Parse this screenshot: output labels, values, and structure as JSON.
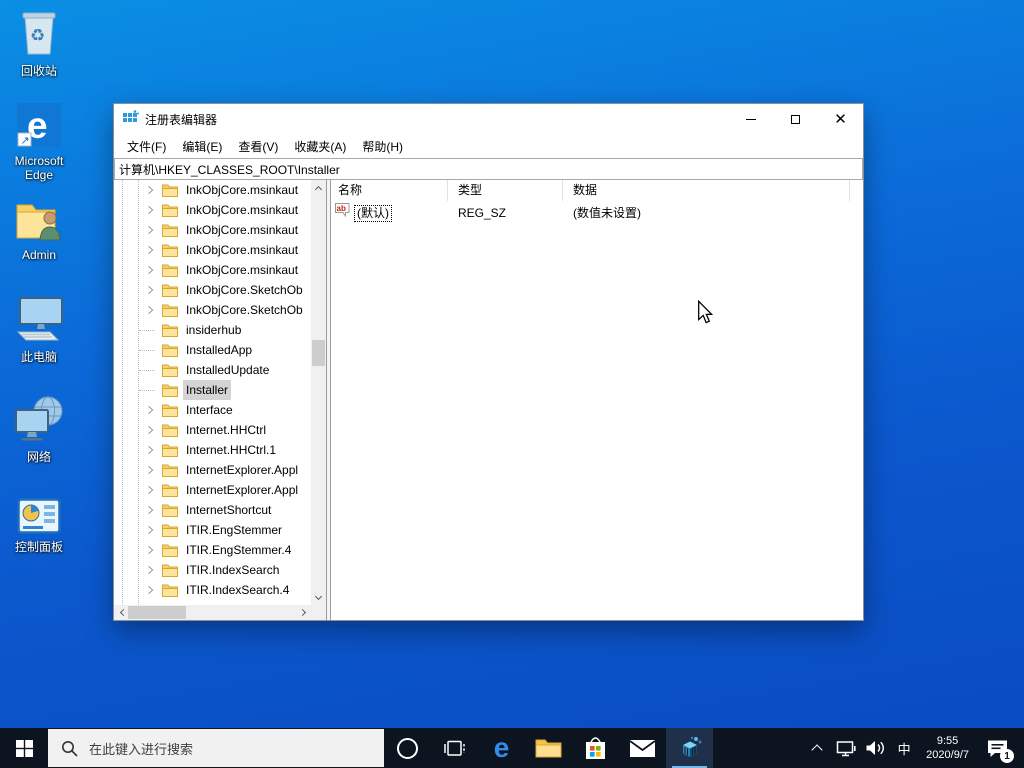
{
  "desktop": {
    "icons": [
      {
        "label": "回收站"
      },
      {
        "label": "Microsoft Edge"
      },
      {
        "label": "Admin"
      },
      {
        "label": "此电脑"
      },
      {
        "label": "网络"
      },
      {
        "label": "控制面板"
      }
    ]
  },
  "window": {
    "title": "注册表编辑器",
    "menu": [
      "文件(F)",
      "编辑(E)",
      "查看(V)",
      "收藏夹(A)",
      "帮助(H)"
    ],
    "address": "计算机\\HKEY_CLASSES_ROOT\\Installer",
    "tree": {
      "items": [
        {
          "label": "InkObjCore.msinkaut",
          "expandable": true
        },
        {
          "label": "InkObjCore.msinkaut",
          "expandable": true
        },
        {
          "label": "InkObjCore.msinkaut",
          "expandable": true
        },
        {
          "label": "InkObjCore.msinkaut",
          "expandable": true
        },
        {
          "label": "InkObjCore.msinkaut",
          "expandable": true
        },
        {
          "label": "InkObjCore.SketchOb",
          "expandable": true
        },
        {
          "label": "InkObjCore.SketchOb",
          "expandable": true
        },
        {
          "label": "insiderhub",
          "expandable": false
        },
        {
          "label": "InstalledApp",
          "expandable": false
        },
        {
          "label": "InstalledUpdate",
          "expandable": false
        },
        {
          "label": "Installer",
          "expandable": false,
          "selected": true
        },
        {
          "label": "Interface",
          "expandable": true
        },
        {
          "label": "Internet.HHCtrl",
          "expandable": true
        },
        {
          "label": "Internet.HHCtrl.1",
          "expandable": true
        },
        {
          "label": "InternetExplorer.Appl",
          "expandable": true
        },
        {
          "label": "InternetExplorer.Appl",
          "expandable": true
        },
        {
          "label": "InternetShortcut",
          "expandable": true
        },
        {
          "label": "ITIR.EngStemmer",
          "expandable": true
        },
        {
          "label": "ITIR.EngStemmer.4",
          "expandable": true
        },
        {
          "label": "ITIR.IndexSearch",
          "expandable": true
        },
        {
          "label": "ITIR.IndexSearch.4",
          "expandable": true
        }
      ]
    },
    "list": {
      "columns": [
        "名称",
        "类型",
        "数据"
      ],
      "rows": [
        {
          "name": "(默认)",
          "type": "REG_SZ",
          "data": "(数值未设置)"
        }
      ]
    }
  },
  "taskbar": {
    "search": {
      "placeholder": "在此键入进行搜索"
    },
    "tray": {
      "ime": "中",
      "time": "9:55",
      "date": "2020/9/7",
      "notification_count": "1"
    }
  },
  "colors": {
    "desktop_blue": "#0b63d6",
    "taskbar": "#0c1420",
    "active_app_underline": "#76b9ed",
    "selection_gray": "#d4d4d4"
  }
}
